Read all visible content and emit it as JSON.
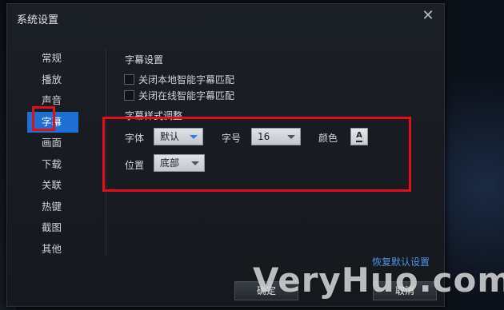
{
  "dialog": {
    "title": "系统设置",
    "close_symbol": "✕"
  },
  "sidebar": {
    "items": [
      {
        "label": "常规"
      },
      {
        "label": "播放"
      },
      {
        "label": "声音"
      },
      {
        "label": "字幕",
        "active": true
      },
      {
        "label": "画面"
      },
      {
        "label": "下载"
      },
      {
        "label": "关联"
      },
      {
        "label": "热键"
      },
      {
        "label": "截图"
      },
      {
        "label": "其他"
      }
    ]
  },
  "subtitle_settings": {
    "section_title": "字幕设置",
    "options": [
      {
        "label": "关闭本地智能字幕匹配",
        "checked": false
      },
      {
        "label": "关闭在线智能字幕匹配",
        "checked": false
      }
    ]
  },
  "style_adjust": {
    "section_title": "字幕样式调整",
    "font_label": "字体",
    "font_value": "默认",
    "size_label": "字号",
    "size_value": "16",
    "color_label": "颜色",
    "color_button_letter": "A",
    "position_label": "位置",
    "position_value": "底部"
  },
  "footer": {
    "restore_link": "恢复默认设置",
    "ok_label": "确定",
    "cancel_label": "取消"
  },
  "watermark": "VeryHuo.com",
  "colors": {
    "accent": "#1e6fd1",
    "highlight_box": "#e0101a",
    "link": "#4f96e6"
  }
}
